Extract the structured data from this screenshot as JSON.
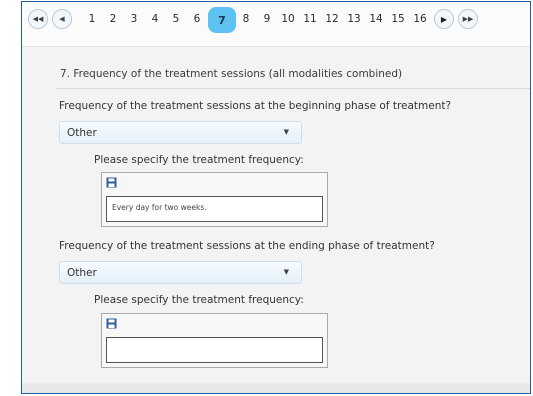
{
  "pager": {
    "first_icon": "first-page-icon",
    "prev_icon": "previous-page-icon",
    "next_icon": "next-page-icon",
    "last_icon": "last-page-icon",
    "pages": [
      "1",
      "2",
      "3",
      "4",
      "5",
      "6",
      "7",
      "8",
      "9",
      "10",
      "11",
      "12",
      "13",
      "14",
      "15",
      "16"
    ],
    "current_page": "7"
  },
  "section": {
    "title": "7. Frequency of the treatment sessions (all modalities combined)"
  },
  "questions": [
    {
      "label": "Frequency of the treatment sessions at the beginning phase of treatment?",
      "selected": "Other",
      "specify_label": "Please specify the treatment frequency:",
      "specify_value": "Every day for two weeks."
    },
    {
      "label": "Frequency of the treatment sessions at the ending phase of treatment?",
      "selected": "Other",
      "specify_label": "Please specify the treatment frequency:",
      "specify_value": ""
    }
  ],
  "colors": {
    "active_page": "#5cc2f2",
    "frame_border": "#1f5fb0",
    "save_icon": "#2d5f9a"
  }
}
